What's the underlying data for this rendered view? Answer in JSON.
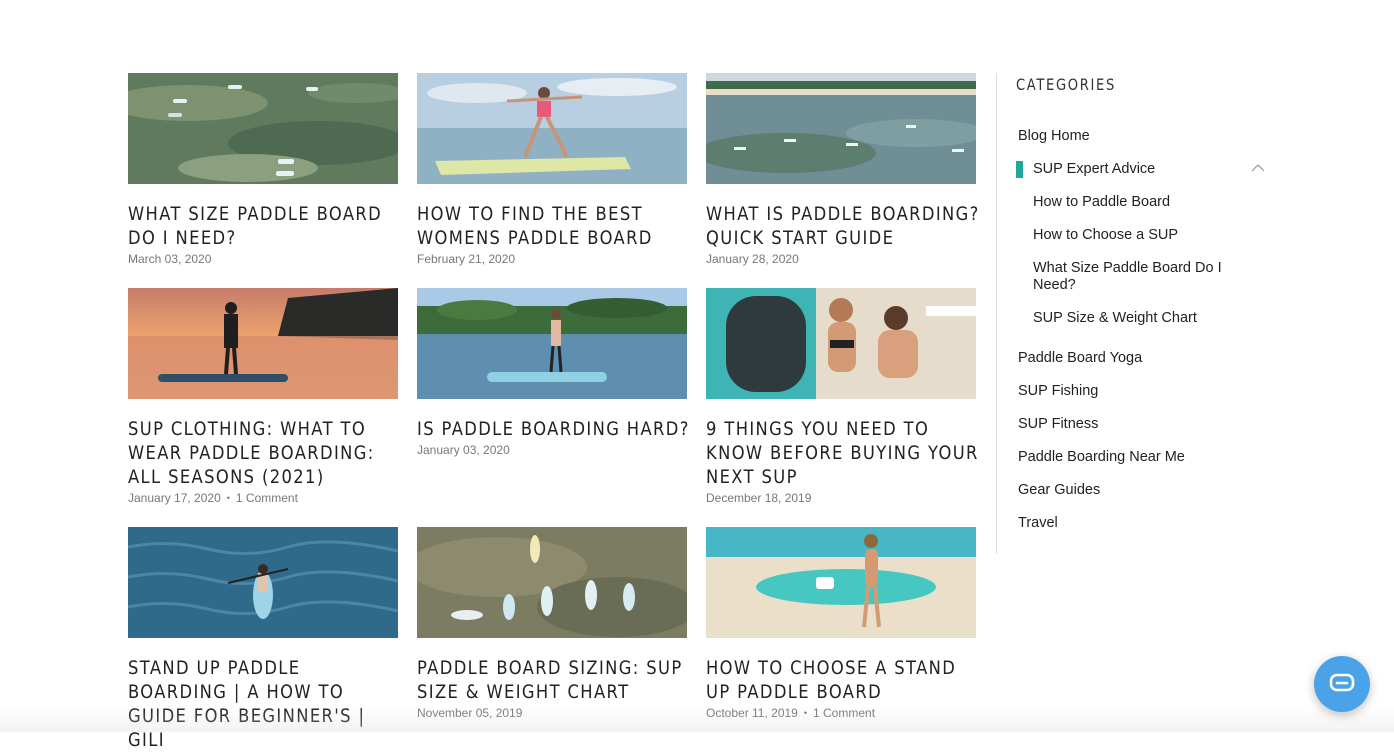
{
  "posts": [
    {
      "title": "What Size Paddle Board Do I Need?",
      "date": "March 03, 2020",
      "comments": ""
    },
    {
      "title": "How to Find the Best Womens Paddle Board",
      "date": "February 21, 2020",
      "comments": ""
    },
    {
      "title": "What is Paddle Boarding? Quick Start Guide",
      "date": "January 28, 2020",
      "comments": ""
    },
    {
      "title": "SUP Clothing: What to Wear Paddle Boarding: All Seasons (2021)",
      "date": "January 17, 2020",
      "comments": "1 Comment"
    },
    {
      "title": "Is Paddle Boarding Hard?",
      "date": "January 03, 2020",
      "comments": ""
    },
    {
      "title": "9 Things You Need to Know Before Buying Your Next SUP",
      "date": "December 18, 2019",
      "comments": ""
    },
    {
      "title": "Stand Up Paddle Boarding | A How To Guide For Beginner's | Gili",
      "date": "",
      "comments": ""
    },
    {
      "title": "Paddle Board Sizing: SUP Size & Weight Chart",
      "date": "November 05, 2019",
      "comments": ""
    },
    {
      "title": "How To Choose A Stand Up Paddle Board",
      "date": "October 11, 2019",
      "comments": "1 Comment"
    }
  ],
  "sidebar": {
    "heading": "Categories",
    "items": [
      {
        "label": "Blog Home"
      },
      {
        "label": "SUP Expert Advice"
      },
      {
        "label": "How to Paddle Board"
      },
      {
        "label": "How to Choose a SUP"
      },
      {
        "label": "What Size Paddle Board Do I Need?"
      },
      {
        "label": "SUP Size & Weight Chart"
      },
      {
        "label": "Paddle Board Yoga"
      },
      {
        "label": "SUP Fishing"
      },
      {
        "label": "SUP Fitness"
      },
      {
        "label": "Paddle Boarding Near Me"
      },
      {
        "label": "Gear Guides"
      },
      {
        "label": "Travel"
      }
    ],
    "active_color": "#1fa79b"
  },
  "chat": {
    "icon": "chat-bubble-icon",
    "color": "#4aa3e9"
  }
}
